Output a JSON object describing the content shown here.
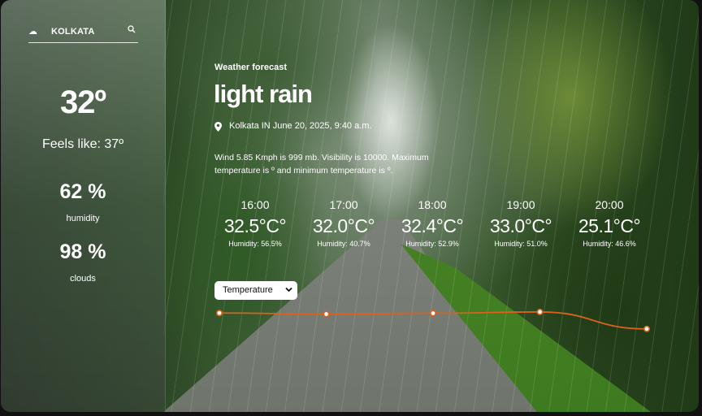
{
  "search": {
    "value": "KOLKATA"
  },
  "current": {
    "temperature": "32º",
    "feels_like": "Feels like:  37º",
    "humidity_value": "62 %",
    "humidity_label": "humidity",
    "clouds_value": "98 %",
    "clouds_label": "clouds"
  },
  "main": {
    "eyebrow": "Weather forecast",
    "condition": "light rain",
    "location": "Kolkata IN June 20, 2025, 9:40 a.m.",
    "description": "Wind 5.85 Kmph is 999 mb. Visibility is 10000. Maximum temperature is º and minimum temperature is º."
  },
  "forecast": [
    {
      "time": "16:00",
      "temp": "32.5°C°",
      "humidity": "Humidity: 56.5%"
    },
    {
      "time": "17:00",
      "temp": "32.0°C°",
      "humidity": "Humidity: 40.7%"
    },
    {
      "time": "18:00",
      "temp": "32.4°C°",
      "humidity": "Humidity: 52.9%"
    },
    {
      "time": "19:00",
      "temp": "33.0°C°",
      "humidity": "Humidity: 51.0%"
    },
    {
      "time": "20:00",
      "temp": "25.1°C°",
      "humidity": "Humidity: 46.6%"
    }
  ],
  "selector": {
    "selected": "Temperature"
  },
  "colors": {
    "line": "#d9621f",
    "point_fill": "#ffffff"
  },
  "chart_data": {
    "type": "line",
    "x": [
      "16:00",
      "17:00",
      "18:00",
      "19:00",
      "20:00"
    ],
    "values": [
      32.5,
      32.0,
      32.4,
      33.0,
      25.1
    ],
    "ylim": [
      22,
      36
    ],
    "grid": false
  },
  "icons": {
    "city": "cloud-icon",
    "search": "search-icon",
    "location": "pin-icon",
    "dropdown": "chevron-down-icon"
  }
}
